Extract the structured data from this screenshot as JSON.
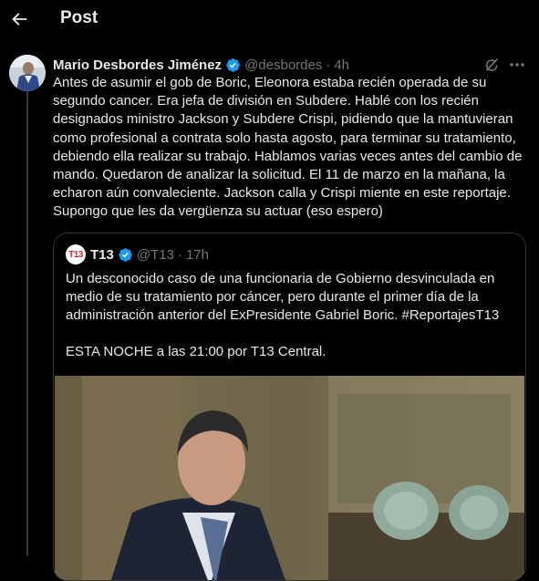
{
  "header": {
    "back_icon": "arrow-left-icon",
    "title": "Post"
  },
  "post": {
    "author_name": "Mario Desbordes Jiménez",
    "verified_icon": "verified-badge-icon",
    "handle": "@desbordes",
    "separator": "·",
    "time": "4h",
    "grok_icon": "grok-icon",
    "more_icon": "more-dots-icon",
    "text": "Antes  de asumir el gob de Boric, Eleonora estaba recién operada de su segundo cancer. Era jefa de división en Subdere. Hablé con los recién designados ministro Jackson y Subdere Crispi, pidiendo que la mantuvieran como profesional a contrata solo hasta agosto, para terminar su tratamiento, debiendo ella realizar su trabajo. Hablamos varias veces antes del cambio de mando. Quedaron de analizar la solicitud. El 11 de marzo en la mañana, la echaron aún convaleciente. Jackson calla y Crispi miente en este reportaje. Supongo que les da vergüenza su actuar (eso espero)"
  },
  "quoted": {
    "logo_text": "T13",
    "author_name": "T13",
    "verified_icon": "verified-badge-icon",
    "handle": "@T13",
    "separator": "·",
    "time": "17h",
    "paragraph1": "Un desconocido caso de una funcionaria de Gobierno desvinculada en medio de su tratamiento por cáncer, pero durante el primer día de la administración anterior del ExPresidente Gabriel Boric. #ReportajesT13",
    "paragraph2": "ESTA NOCHE a las 21:00 por T13 Central.",
    "media": "video-thumbnail"
  },
  "colors": {
    "background": "#000000",
    "text": "#e7e9ea",
    "secondary": "#71767b",
    "border": "#2f3336",
    "verified": "#1d9bf0",
    "t13_red": "#e3262f"
  }
}
